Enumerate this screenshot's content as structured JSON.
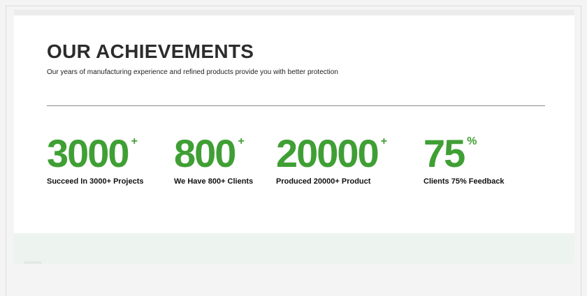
{
  "achievements": {
    "title": "OUR ACHIEVEMENTS",
    "subtitle": "Our years of manufacturing experience and refined products provide you with better protection",
    "stats": [
      {
        "value": "3000",
        "suffix": "+",
        "label": "Succeed In 3000+  Projects"
      },
      {
        "value": "800",
        "suffix": "+",
        "label": "We Have 800+ Clients"
      },
      {
        "value": "20000",
        "suffix": "+",
        "label": "Produced 20000+ Product"
      },
      {
        "value": "75",
        "suffix": "%",
        "label": "Clients 75% Feedback"
      }
    ]
  },
  "colors": {
    "accent_green": "#3f9f34",
    "lower_band": "#edf4ef"
  }
}
